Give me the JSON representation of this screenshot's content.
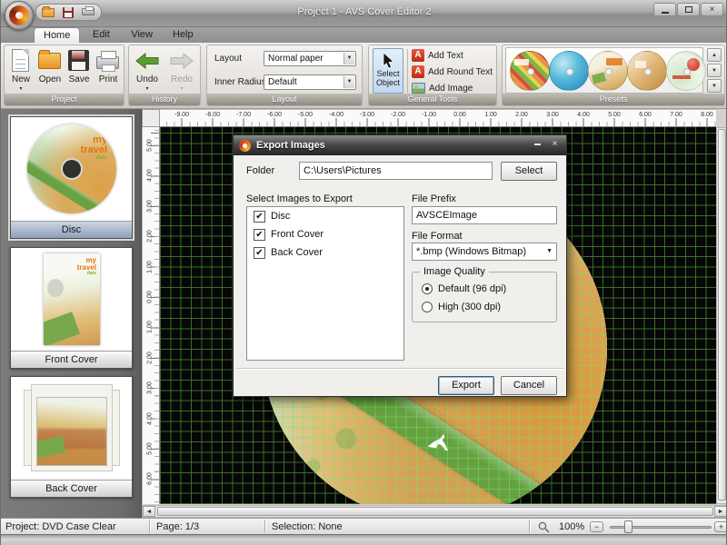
{
  "window": {
    "title": "Project 1 - AVS Cover Editor 2"
  },
  "menu": {
    "tabs": [
      {
        "label": "Home",
        "active": true
      },
      {
        "label": "Edit",
        "active": false
      },
      {
        "label": "View",
        "active": false
      },
      {
        "label": "Help",
        "active": false
      }
    ]
  },
  "ribbon": {
    "project": {
      "label": "Project",
      "new": "New",
      "open": "Open",
      "save": "Save",
      "print": "Print"
    },
    "history": {
      "label": "History",
      "undo": "Undo",
      "redo": "Redo"
    },
    "layout": {
      "label": "Layout",
      "field1_label": "Layout",
      "field1_value": "Normal paper",
      "field2_label": "Inner Radius",
      "field2_value": "Default"
    },
    "general_tools": {
      "label": "General Tools",
      "select_object": "Select Object",
      "add_text": "Add Text",
      "add_round_text": "Add Round Text",
      "add_image": "Add Image"
    },
    "presets": {
      "label": "Presets"
    }
  },
  "sidebar": {
    "items": [
      {
        "label": "Disc",
        "selected": true
      },
      {
        "label": "Front Cover",
        "selected": false
      },
      {
        "label": "Back Cover",
        "selected": false
      }
    ],
    "disc_text": {
      "l1": "my",
      "l2": "travel",
      "l3": "date"
    }
  },
  "rulers": {
    "horizontal": [
      "-9.00",
      "-8.00",
      "-7.00",
      "-6.00",
      "-5.00",
      "-4.00",
      "-3.00",
      "-2.00",
      "-1.00",
      "0.00",
      "1.00",
      "2.00",
      "3.00",
      "4.00",
      "5.00",
      "6.00",
      "7.00",
      "8.00"
    ],
    "vertical": [
      "5.00",
      "4.00",
      "3.00",
      "2.00",
      "1.00",
      "0.00",
      "1.00",
      "2.00",
      "3.00",
      "4.00",
      "5.00",
      "6.00"
    ]
  },
  "dialog": {
    "title": "Export Images",
    "folder_label": "Folder",
    "folder_value": "C:\\Users\\Pictures",
    "select_button": "Select",
    "list_label": "Select Images to Export",
    "items": [
      {
        "label": "Disc",
        "checked": true
      },
      {
        "label": "Front Cover",
        "checked": true
      },
      {
        "label": "Back Cover",
        "checked": true
      }
    ],
    "file_prefix_label": "File Prefix",
    "file_prefix_value": "AVSCEImage",
    "file_format_label": "File Format",
    "file_format_value": "*.bmp (Windows Bitmap)",
    "quality": {
      "label": "Image Quality",
      "options": [
        {
          "label": "Default (96 dpi)",
          "selected": true
        },
        {
          "label": "High (300 dpi)",
          "selected": false
        }
      ]
    },
    "export_button": "Export",
    "cancel_button": "Cancel"
  },
  "statusbar": {
    "project": "Project: DVD Case Clear",
    "page": "Page: 1/3",
    "selection": "Selection: None",
    "zoom": "100%"
  },
  "colors": {
    "canvas_bg": "#070707",
    "grid_green": "#408030",
    "select_tool_highlight": "#cfe2f5",
    "preset_orange": "#e07614"
  }
}
